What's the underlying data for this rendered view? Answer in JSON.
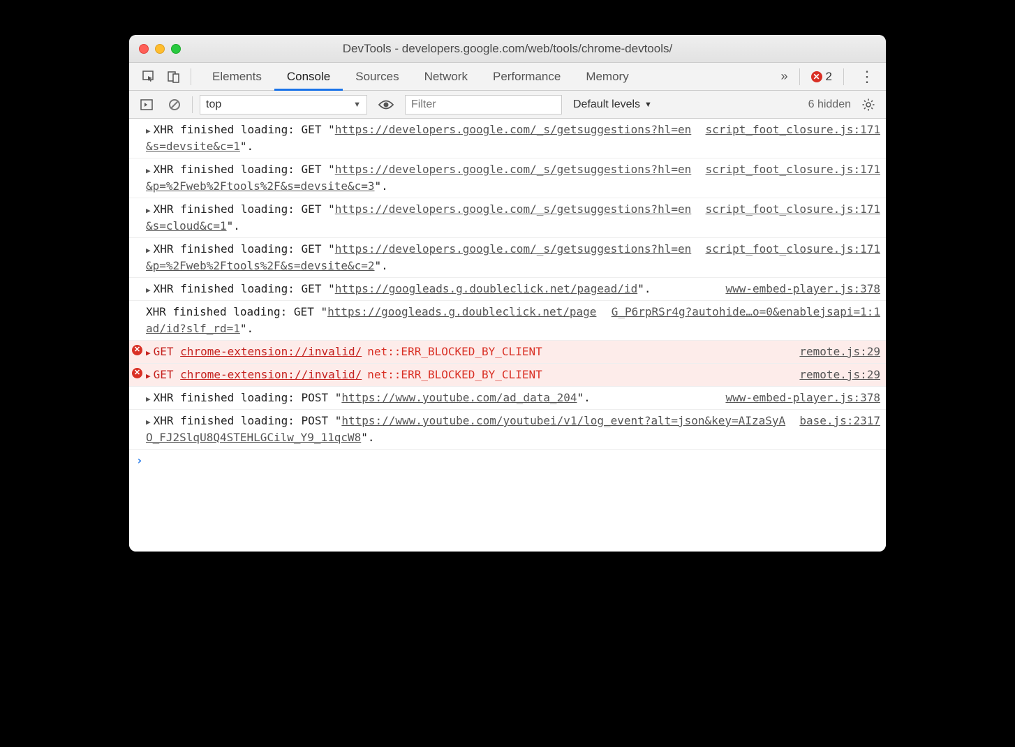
{
  "window": {
    "title": "DevTools - developers.google.com/web/tools/chrome-devtools/"
  },
  "tabs": {
    "elements": "Elements",
    "console": "Console",
    "sources": "Sources",
    "network": "Network",
    "performance": "Performance",
    "memory": "Memory",
    "active": "console",
    "overflow": "»",
    "error_count": "2",
    "more": "⋮"
  },
  "toolbar": {
    "context": "top",
    "context_caret": "▼",
    "filter_placeholder": "Filter",
    "levels": "Default levels",
    "levels_caret": "▼",
    "hidden": "6 hidden"
  },
  "rows": [
    {
      "type": "xhr",
      "expand": true,
      "prefix": "XHR finished loading: GET \"",
      "url": "https://developers.google.com/_s/getsuggestions?hl=en&s=devsite&c=1",
      "suffix": "\".",
      "source": "script_foot_closure.js:171"
    },
    {
      "type": "xhr",
      "expand": true,
      "prefix": "XHR finished loading: GET \"",
      "url": "https://developers.google.com/_s/getsuggestions?hl=en&p=%2Fweb%2Ftools%2F&s=devsite&c=3",
      "suffix": "\".",
      "source": "script_foot_closure.js:171"
    },
    {
      "type": "xhr",
      "expand": true,
      "prefix": "XHR finished loading: GET \"",
      "url": "https://developers.google.com/_s/getsuggestions?hl=en&s=cloud&c=1",
      "suffix": "\".",
      "source": "script_foot_closure.js:171"
    },
    {
      "type": "xhr",
      "expand": true,
      "prefix": "XHR finished loading: GET \"",
      "url": "https://developers.google.com/_s/getsuggestions?hl=en&p=%2Fweb%2Ftools%2F&s=devsite&c=2",
      "suffix": "\".",
      "source": "script_foot_closure.js:171"
    },
    {
      "type": "xhr",
      "expand": true,
      "prefix": "XHR finished loading: GET \"",
      "url": "https://googleads.g.doubleclick.net/pagead/id",
      "suffix": "\".",
      "source": "www-embed-player.js:378"
    },
    {
      "type": "xhr",
      "expand": false,
      "prefix": "XHR finished loading: GET \"",
      "url": "https://googleads.g.doubleclick.net/pagead/id?slf_rd=1",
      "suffix": "\".",
      "source": "G_P6rpRSr4g?autohide…o=0&enablejsapi=1:1"
    },
    {
      "type": "err",
      "expand": true,
      "method": "GET",
      "url": "chrome-extension://invalid/",
      "code": "net::ERR_BLOCKED_BY_CLIENT",
      "source": "remote.js:29"
    },
    {
      "type": "err",
      "expand": true,
      "method": "GET",
      "url": "chrome-extension://invalid/",
      "code": "net::ERR_BLOCKED_BY_CLIENT",
      "source": "remote.js:29"
    },
    {
      "type": "xhr",
      "expand": true,
      "prefix": "XHR finished loading: POST \"",
      "url": "https://www.youtube.com/ad_data_204",
      "suffix": "\".",
      "source": "www-embed-player.js:378"
    },
    {
      "type": "xhr",
      "expand": true,
      "prefix": "XHR finished loading: POST \"",
      "url": "https://www.youtube.com/youtubei/v1/log_event?alt=json&key=AIzaSyAO_FJ2SlqU8Q4STEHLGCilw_Y9_11qcW8",
      "suffix": "\".",
      "source": "base.js:2317"
    }
  ],
  "prompt": "›"
}
